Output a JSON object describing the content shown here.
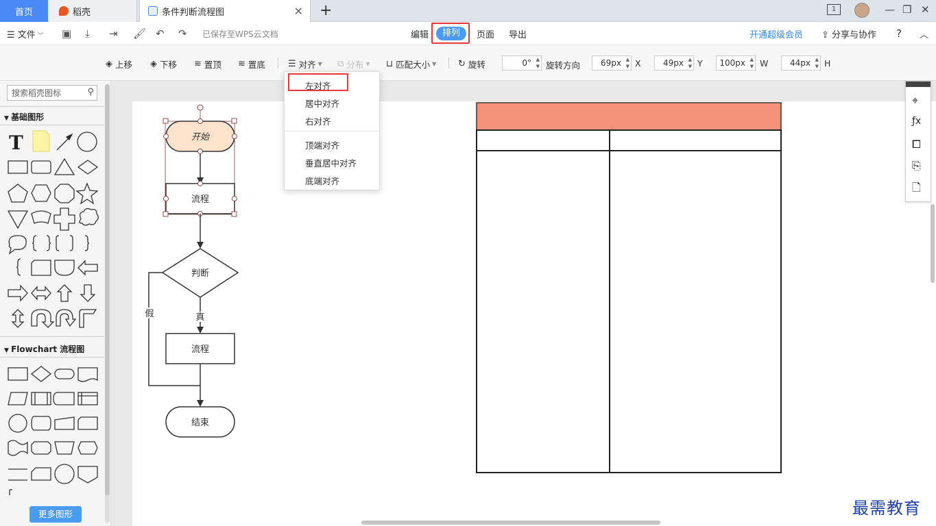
{
  "tabs": {
    "home": "首页",
    "daoke": "稻壳",
    "document": "条件判断流程图"
  },
  "window": {
    "page_indicator": "1"
  },
  "toolbar1": {
    "file": "文件",
    "saved_status": "已保存至WPS云文档",
    "edit": "编辑",
    "arrange": "排列",
    "page": "页面",
    "export": "导出",
    "vip": "开通超级会员",
    "share": "分享与协作",
    "help": "?"
  },
  "toolbar2": {
    "move_up": "上移",
    "move_down": "下移",
    "to_top": "置顶",
    "to_bottom": "置底",
    "align": "对齐",
    "distribute": "分布",
    "match_size": "匹配大小",
    "rotate": "旋转",
    "rotate_value": "0°",
    "rotate_dir": "旋转方向",
    "x_value": "69px",
    "x_label": "X",
    "y_value": "49px",
    "y_label": "Y",
    "w_value": "100px",
    "w_label": "W",
    "h_value": "44px",
    "h_label": "H"
  },
  "align_menu": {
    "items": [
      "左对齐",
      "居中对齐",
      "右对齐",
      "顶端对齐",
      "垂直居中对齐",
      "底端对齐"
    ]
  },
  "left_panel": {
    "search_placeholder": "搜索稻壳图标",
    "section_basic": "基础图形",
    "section_flowchart": "Flowchart 流程图",
    "more_shapes": "更多图形"
  },
  "flowchart": {
    "start": "开始",
    "process1": "流程",
    "decision": "判断",
    "true_label": "真",
    "false_label": "假",
    "process2": "流程",
    "end": "结束"
  },
  "colors": {
    "accent": "#4a9cf2",
    "highlight_red": "#e8363a",
    "start_fill": "#fde2cc",
    "table_header": "#f4937a"
  },
  "watermark": "最需教育"
}
